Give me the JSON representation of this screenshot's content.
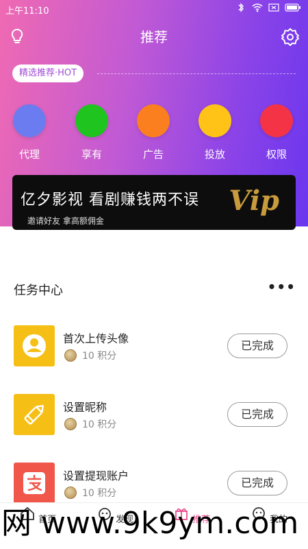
{
  "status_bar": {
    "time": "上午11:10"
  },
  "nav": {
    "title": "推荐"
  },
  "hot_tag": "精选推荐·HOT",
  "categories": [
    {
      "label": "代理",
      "color": "#6b7cf0"
    },
    {
      "label": "享有",
      "color": "#1fc41f"
    },
    {
      "label": "广告",
      "color": "#fb7f1e"
    },
    {
      "label": "投放",
      "color": "#ffc318"
    },
    {
      "label": "权限",
      "color": "#f53346"
    }
  ],
  "banner": {
    "main": "亿夕影视 看剧赚钱两不误",
    "sub": "邀请好友 拿高额佣金",
    "vip": "Vip"
  },
  "task_center": {
    "title": "任务中心",
    "more": "•••",
    "tasks": [
      {
        "title": "首次上传头像",
        "points": "10 积分",
        "button": "已完成",
        "icon": "avatar-icon",
        "color": "#f6bf16"
      },
      {
        "title": "设置昵称",
        "points": "10 积分",
        "button": "已完成",
        "icon": "pencil-icon",
        "color": "#f6bf16"
      },
      {
        "title": "设置提现账户",
        "points": "10 积分",
        "button": "已完成",
        "icon": "alipay-icon",
        "color": "#f1564a"
      }
    ]
  },
  "tabbar": [
    {
      "label": "首页",
      "icon": "home-icon"
    },
    {
      "label": "发现",
      "icon": "discover-icon"
    },
    {
      "label": "推荐",
      "icon": "gift-icon",
      "active": true
    },
    {
      "label": "我的",
      "icon": "profile-icon"
    }
  ],
  "watermark": "网 www.9k9ym.com"
}
